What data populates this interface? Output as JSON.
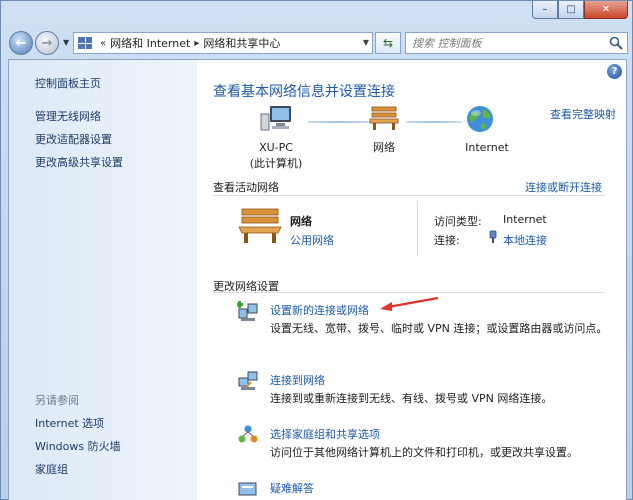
{
  "window": {
    "minimize_glyph": "–",
    "maximize_glyph": "□",
    "close_glyph": "✕"
  },
  "nav": {
    "back_glyph": "←",
    "forward_glyph": "→",
    "refresh_glyph": "⇆",
    "breadcrumb_lead": "«",
    "breadcrumb": [
      "网络和 Internet",
      "网络和共享中心"
    ],
    "search_placeholder": "搜索 控制面板"
  },
  "sidebar": {
    "links": [
      "控制面板主页",
      "管理无线网络",
      "更改适配器设置",
      "更改高级共享设置"
    ],
    "see_also_header": "另请参阅",
    "see_also": [
      "Internet 选项",
      "Windows 防火墙",
      "家庭组"
    ]
  },
  "main": {
    "help_glyph": "?",
    "title": "查看基本网络信息并设置连接",
    "full_map_link": "查看完整映射",
    "map": {
      "computer_name": "XU-PC",
      "computer_sub": "(此计算机)",
      "network": "网络",
      "internet": "Internet"
    },
    "active": {
      "header": "查看活动网络",
      "connect_link": "连接或断开连接",
      "name": "网络",
      "type": "公用网络",
      "access_label": "访问类型:",
      "access_value": "Internet",
      "conn_label": "连接:",
      "conn_value": "本地连接"
    },
    "change": {
      "header": "更改网络设置",
      "tasks": [
        {
          "link": "设置新的连接或网络",
          "desc": "设置无线、宽带、拨号、临时或 VPN 连接；或设置路由器或访问点。"
        },
        {
          "link": "连接到网络",
          "desc": "连接到或重新连接到无线、有线、拨号或 VPN 网络连接。"
        },
        {
          "link": "选择家庭组和共享选项",
          "desc": "访问位于其他网络计算机上的文件和打印机，或更改共享设置。"
        },
        {
          "link": "疑难解答",
          "desc": ""
        }
      ]
    }
  },
  "colors": {
    "link": "#1e5aa8",
    "annotation_arrow": "#e0312a"
  }
}
